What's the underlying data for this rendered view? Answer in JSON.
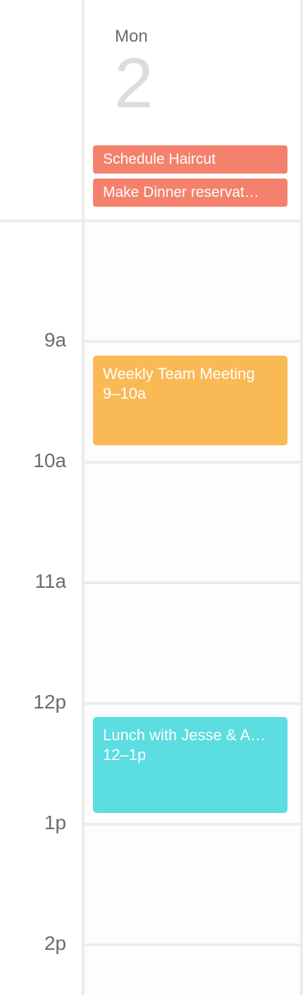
{
  "day": {
    "weekday": "Mon",
    "date": "2"
  },
  "all_day_events": [
    {
      "title": "Schedule Haircut",
      "color": "#f4816c"
    },
    {
      "title": "Make Dinner reservat…",
      "color": "#f4816c"
    }
  ],
  "hour_labels": [
    "9a",
    "10a",
    "11a",
    "12p",
    "1p",
    "2p"
  ],
  "events": [
    {
      "title": "Weekly Team Meeting",
      "time": "9–10a",
      "color": "#f9b955"
    },
    {
      "title": "Lunch with Jesse & A…",
      "time": "12–1p",
      "color": "#5bdde1"
    }
  ]
}
